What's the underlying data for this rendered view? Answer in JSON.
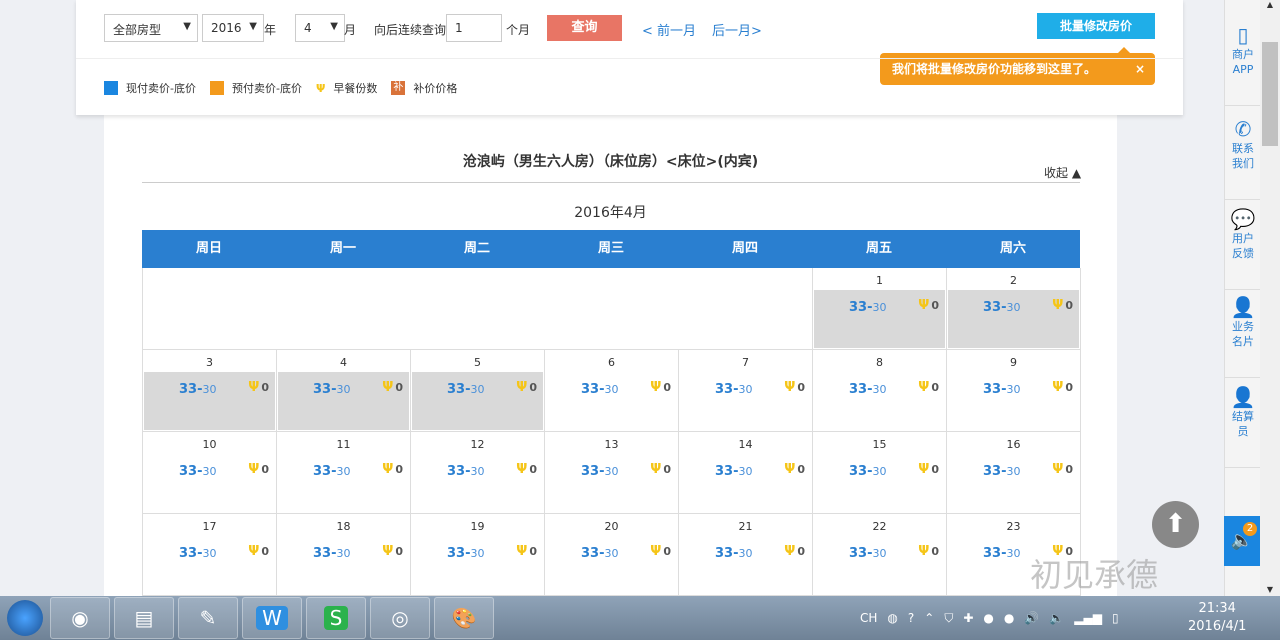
{
  "toolbar": {
    "room_type": "全部房型",
    "year": "2016",
    "year_label": "年",
    "month": "4",
    "month_label": "月",
    "continue_label": "向后连续查询",
    "months_count": "1",
    "months_unit": "个月",
    "query": "查询",
    "prev": "< 前一月",
    "next": "后一月>",
    "batch": "批量修改房价"
  },
  "tip": {
    "text": "我们将批量修改房价功能移到这里了。",
    "close": "×"
  },
  "legend": [
    {
      "label": "现付卖价-底价",
      "color": "#1a86e0"
    },
    {
      "label": "预付卖价-底价",
      "color": "#f39a1c"
    },
    {
      "label": "早餐份数",
      "icon": "fork-knife"
    },
    {
      "label": "补价价格",
      "icon": "补"
    }
  ],
  "room": {
    "title": "沧浪屿（男生六人房）（床位房）<床位>(内宾)",
    "collapse": "收起 ▲",
    "month_title": "2016年4月"
  },
  "weekdays": [
    "周日",
    "周一",
    "周二",
    "周三",
    "周四",
    "周五",
    "周六"
  ],
  "days": [
    {
      "d": "1",
      "p": "33",
      "b": "30",
      "k": "0",
      "past": true
    },
    {
      "d": "2",
      "p": "33",
      "b": "30",
      "k": "0",
      "past": true
    },
    {
      "d": "3",
      "p": "33",
      "b": "30",
      "k": "0",
      "past": true
    },
    {
      "d": "4",
      "p": "33",
      "b": "30",
      "k": "0",
      "past": true
    },
    {
      "d": "5",
      "p": "33",
      "b": "30",
      "k": "0",
      "past": true
    },
    {
      "d": "6",
      "p": "33",
      "b": "30",
      "k": "0"
    },
    {
      "d": "7",
      "p": "33",
      "b": "30",
      "k": "0"
    },
    {
      "d": "8",
      "p": "33",
      "b": "30",
      "k": "0"
    },
    {
      "d": "9",
      "p": "33",
      "b": "30",
      "k": "0"
    },
    {
      "d": "10",
      "p": "33",
      "b": "30",
      "k": "0"
    },
    {
      "d": "11",
      "p": "33",
      "b": "30",
      "k": "0"
    },
    {
      "d": "12",
      "p": "33",
      "b": "30",
      "k": "0"
    },
    {
      "d": "13",
      "p": "33",
      "b": "30",
      "k": "0"
    },
    {
      "d": "14",
      "p": "33",
      "b": "30",
      "k": "0"
    },
    {
      "d": "15",
      "p": "33",
      "b": "30",
      "k": "0"
    },
    {
      "d": "16",
      "p": "33",
      "b": "30",
      "k": "0"
    },
    {
      "d": "17",
      "p": "33",
      "b": "30",
      "k": "0"
    },
    {
      "d": "18",
      "p": "33",
      "b": "30",
      "k": "0"
    },
    {
      "d": "19",
      "p": "33",
      "b": "30",
      "k": "0"
    },
    {
      "d": "20",
      "p": "33",
      "b": "30",
      "k": "0"
    },
    {
      "d": "21",
      "p": "33",
      "b": "30",
      "k": "0"
    },
    {
      "d": "22",
      "p": "33",
      "b": "30",
      "k": "0"
    },
    {
      "d": "23",
      "p": "33",
      "b": "30",
      "k": "0"
    }
  ],
  "sidebar": [
    {
      "label": "商户\nAPP",
      "icon": "phone-device"
    },
    {
      "label": "联系\n我们",
      "icon": "phone"
    },
    {
      "label": "用户\n反馈",
      "icon": "chat"
    },
    {
      "label": "业务\n名片",
      "icon": "user"
    },
    {
      "label": "结算\n员",
      "icon": "user"
    }
  ],
  "notify_count": "2",
  "watermark": "初见承德",
  "taskbar": {
    "lang": "CH",
    "time": "21:34",
    "date": "2016/4/1"
  }
}
